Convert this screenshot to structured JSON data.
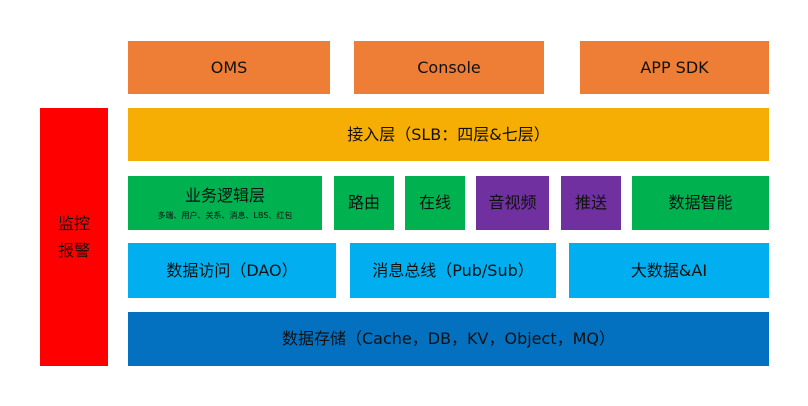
{
  "diagram": {
    "top_layer": {
      "oms": "OMS",
      "console": "Console",
      "app_sdk": "APP SDK"
    },
    "access_layer": "接入层（SLB：四层&七层）",
    "business_row": {
      "business_logic": {
        "title": "业务逻辑层",
        "subtitle": "多端、用户、关系、消息、LBS、红包"
      },
      "routing": "路由",
      "online": "在线",
      "audio_video": "音视频",
      "push": "推送",
      "data_intelligence": "数据智能"
    },
    "data_row": {
      "dao": "数据访问（DAO）",
      "message_bus": "消息总线（Pub/Sub）",
      "big_data_ai": "大数据&AI"
    },
    "storage": "数据存储（Cache，DB，KV，Object，MQ）",
    "monitoring": {
      "line1": "监控",
      "line2": "报警"
    },
    "colors": {
      "orange": "#EE7D35",
      "yellow": "#F7AE04",
      "green": "#00B14F",
      "purple": "#7030A0",
      "sky": "#01AEEF",
      "navy": "#0470C0",
      "red": "#FF0000"
    }
  }
}
